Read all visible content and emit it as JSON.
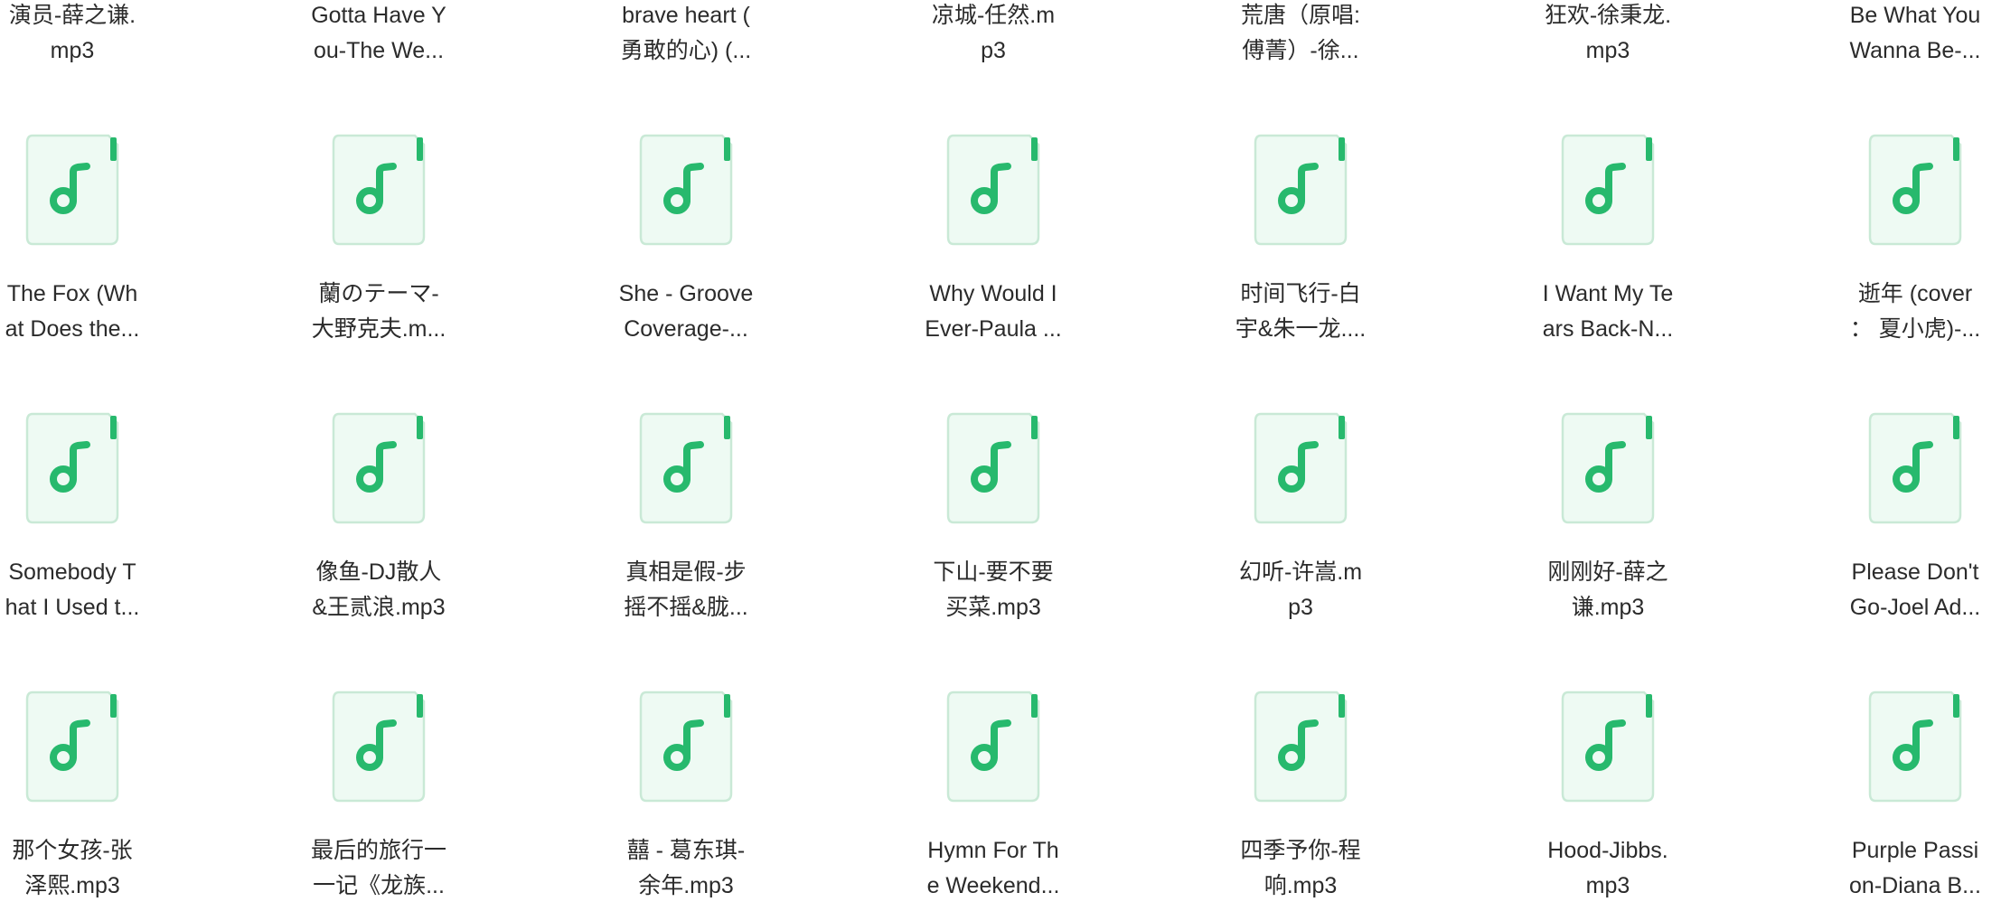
{
  "view": "file-browser-icon-grid",
  "accent_color": "#27b96d",
  "icon_fill": "#eefaf3",
  "icon_border": "#c9e9d6",
  "file_icon_name": "music-file-icon",
  "files": [
    {
      "line1": "演员-薛之谦.",
      "line2": "mp3",
      "has_icon": false
    },
    {
      "line1": "Gotta Have Y",
      "line2": "ou-The We...",
      "has_icon": false
    },
    {
      "line1": "brave heart (",
      "line2": "勇敢的心) (...",
      "has_icon": false
    },
    {
      "line1": "凉城-任然.m",
      "line2": "p3",
      "has_icon": false
    },
    {
      "line1": "荒唐（原唱:",
      "line2": "傅菁）-徐...",
      "has_icon": false
    },
    {
      "line1": "狂欢-徐秉龙.",
      "line2": "mp3",
      "has_icon": false
    },
    {
      "line1": "Be What You",
      "line2": "Wanna Be-...",
      "has_icon": false
    },
    {
      "line1": "The Fox (Wh",
      "line2": "at Does the...",
      "has_icon": true
    },
    {
      "line1": "蘭のテーマ-",
      "line2": "大野克夫.m...",
      "has_icon": true
    },
    {
      "line1": "She - Groove",
      "line2": "Coverage-...",
      "has_icon": true
    },
    {
      "line1": "Why Would I",
      "line2": "Ever-Paula ...",
      "has_icon": true
    },
    {
      "line1": "时间飞行-白",
      "line2": "宇&朱一龙....",
      "has_icon": true
    },
    {
      "line1": "I Want My Te",
      "line2": "ars Back-N...",
      "has_icon": true
    },
    {
      "line1": "逝年 (cover",
      "line2": "：  夏小虎)-...",
      "has_icon": true
    },
    {
      "line1": "Somebody T",
      "line2": "hat I Used t...",
      "has_icon": true
    },
    {
      "line1": "像鱼-DJ散人",
      "line2": "&王贰浪.mp3",
      "has_icon": true
    },
    {
      "line1": "真相是假-步",
      "line2": "摇不摇&胧...",
      "has_icon": true
    },
    {
      "line1": "下山-要不要",
      "line2": "买菜.mp3",
      "has_icon": true
    },
    {
      "line1": "幻听-许嵩.m",
      "line2": "p3",
      "has_icon": true
    },
    {
      "line1": "刚刚好-薛之",
      "line2": "谦.mp3",
      "has_icon": true
    },
    {
      "line1": "Please Don't",
      "line2": "Go-Joel Ad...",
      "has_icon": true
    },
    {
      "line1": "那个女孩-张",
      "line2": "泽熙.mp3",
      "has_icon": true
    },
    {
      "line1": "最后的旅行一",
      "line2": "一记《龙族...",
      "has_icon": true
    },
    {
      "line1": "囍 - 葛东琪-",
      "line2": "余年.mp3",
      "has_icon": true
    },
    {
      "line1": "Hymn For Th",
      "line2": "e Weekend...",
      "has_icon": true
    },
    {
      "line1": "四季予你-程",
      "line2": "响.mp3",
      "has_icon": true
    },
    {
      "line1": "Hood-Jibbs.",
      "line2": "mp3",
      "has_icon": true
    },
    {
      "line1": "Purple Passi",
      "line2": "on-Diana B...",
      "has_icon": true
    }
  ]
}
